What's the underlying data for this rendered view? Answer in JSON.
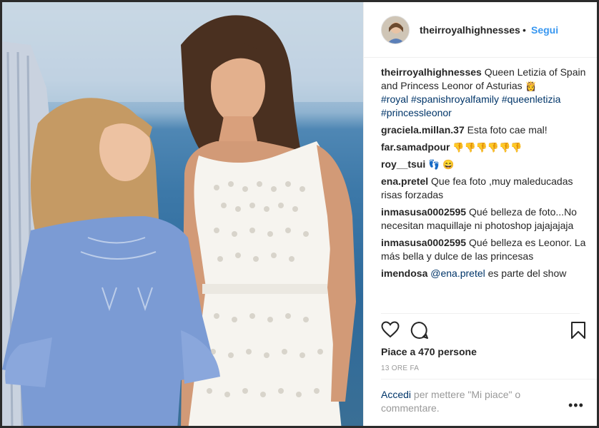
{
  "header": {
    "username": "theirroyalhighnesses",
    "separator": "•",
    "follow_label": "Segui"
  },
  "caption": {
    "username": "theirroyalhighnesses",
    "text": "Queen Letizia of Spain and Princess Leonor of Asturias",
    "emoji": "👸",
    "hashtags": "#royal #spanishroyalfamily #queenletizia #princessleonor"
  },
  "comments": [
    {
      "user": "graciela.millan.37",
      "text": "Esta foto cae mal!"
    },
    {
      "user": "far.samadpour",
      "text": "👎👎👎👎👎👎"
    },
    {
      "user": "roy__tsui",
      "text": "👣 😄"
    },
    {
      "user": "ena.pretel",
      "text": "Que fea foto ,muy maleducadas risas forzadas"
    },
    {
      "user": "inmasusa0002595",
      "text": "Qué belleza de foto...No necesitan maquillaje ni photoshop jajajajaja"
    },
    {
      "user": "inmasusa0002595",
      "text": "Qué belleza es Leonor. La más bella y dulce de las princesas"
    },
    {
      "user": "imendosa",
      "mention": "@ena.pretel",
      "text": "es parte del show"
    }
  ],
  "likes_text": "Piace a 470 persone",
  "timestamp": "13 ORE FA",
  "add_comment": {
    "login_label": "Accedi",
    "rest": "per mettere \"Mi piace\" o commentare."
  },
  "more_label": "•••",
  "icons": {
    "like": "heart-icon",
    "comment": "comment-icon",
    "save": "bookmark-icon",
    "more": "more-options-icon"
  },
  "colors": {
    "link_blue": "#3897f0",
    "hashtag_blue": "#003569",
    "muted_gray": "#999999"
  }
}
